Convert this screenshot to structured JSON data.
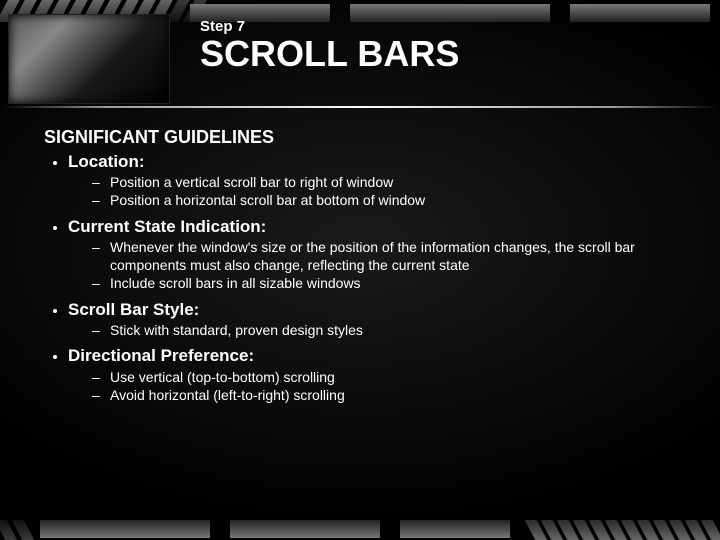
{
  "header": {
    "step": "Step 7",
    "title": "SCROLL BARS"
  },
  "body": {
    "heading": "SIGNIFICANT GUIDELINES",
    "items": [
      {
        "title": "Location:",
        "subs": [
          "Position a vertical scroll bar to right of window",
          "Position a horizontal scroll bar at bottom of window"
        ]
      },
      {
        "title": "Current State Indication:",
        "subs": [
          "Whenever the window's size or the position of the information changes, the scroll bar components must also change, reflecting the current state",
          "Include scroll bars in all sizable windows"
        ]
      },
      {
        "title": "Scroll Bar Style:",
        "subs": [
          "Stick with standard, proven design styles"
        ]
      },
      {
        "title": "Directional Preference:",
        "subs": [
          "Use vertical (top-to-bottom) scrolling",
          "Avoid horizontal (left-to-right) scrolling"
        ]
      }
    ]
  }
}
